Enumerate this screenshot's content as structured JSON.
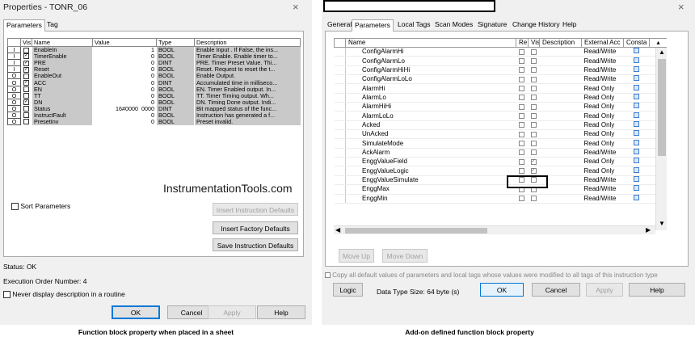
{
  "left_window": {
    "title": "Properties - TONR_06",
    "close": "×",
    "tabs": [
      "Parameters",
      "Tag"
    ],
    "columns": [
      "Vis",
      "Name",
      "Value",
      "Type",
      "Description"
    ],
    "rows": [
      {
        "io": "I",
        "vis": false,
        "name": "EnableIn",
        "value": "1",
        "type": "BOOL",
        "desc": "Enable Input . If False, the ins..."
      },
      {
        "io": "I",
        "vis": true,
        "name": "TimerEnable",
        "value": "0",
        "type": "BOOL",
        "desc": "Timer Enable. Enable timer to..."
      },
      {
        "io": "I",
        "vis": true,
        "name": "PRE",
        "value": "0",
        "type": "DINT",
        "desc": "PRE. Timer Preset Value. Thi..."
      },
      {
        "io": "I",
        "vis": true,
        "name": "Reset",
        "value": "0",
        "type": "BOOL",
        "desc": "Reset. Request to reset the t..."
      },
      {
        "io": "O",
        "vis": false,
        "name": "EnableOut",
        "value": "0",
        "type": "BOOL",
        "desc": "Enable Output."
      },
      {
        "io": "O",
        "vis": true,
        "name": "ACC",
        "value": "0",
        "type": "DINT",
        "desc": "Accumulated time in milliseco..."
      },
      {
        "io": "O",
        "vis": false,
        "name": "EN",
        "value": "0",
        "type": "BOOL",
        "desc": "EN. Timer Enabled output. In..."
      },
      {
        "io": "O",
        "vis": false,
        "name": "TT",
        "value": "0",
        "type": "BOOL",
        "desc": "TT. Timer Timing output. Wh..."
      },
      {
        "io": "O",
        "vis": true,
        "name": "DN",
        "value": "0",
        "type": "BOOL",
        "desc": "DN. Timing Done output. Indi..."
      },
      {
        "io": "O",
        "vis": false,
        "name": "Status",
        "value": "16#0000_0000",
        "type": "DINT",
        "desc": "Bit mapped status of the func..."
      },
      {
        "io": "O",
        "vis": false,
        "name": "InstructFault",
        "value": "0",
        "type": "BOOL",
        "desc": "Instruction has generated a f..."
      },
      {
        "io": "O",
        "vis": false,
        "name": "PresetInv",
        "value": "0",
        "type": "BOOL",
        "desc": "Preset invalid."
      }
    ],
    "watermark": "InstrumentationTools.com",
    "sort_label": "Sort Parameters",
    "btn_insert_instr": "Insert Instruction Defaults",
    "btn_insert_factory": "Insert Factory Defaults",
    "btn_save_instr": "Save Instruction Defaults",
    "status": "Status:  OK",
    "exec_order": "Execution Order Number:  4",
    "never_display": "Never display description in a routine",
    "ok": "OK",
    "cancel": "Cancel",
    "apply": "Apply",
    "help": "Help",
    "caption": "Function block property when placed in a sheet"
  },
  "right_window": {
    "close": "×",
    "tabs": [
      "General",
      "Parameters",
      "Local Tags",
      "Scan Modes",
      "Signature",
      "Change History",
      "Help"
    ],
    "columns": [
      "Name",
      "Re",
      "Vis",
      "Description",
      "External Acc",
      "Consta"
    ],
    "rows": [
      {
        "name": "ConfigAlarmHi",
        "re": false,
        "vis": false,
        "access": "Read/Write"
      },
      {
        "name": "ConfigAlarmLo",
        "re": false,
        "vis": false,
        "access": "Read/Write"
      },
      {
        "name": "ConfigAlarmHiHi",
        "re": false,
        "vis": false,
        "access": "Read/Write"
      },
      {
        "name": "ConfigAlarmLoLo",
        "re": false,
        "vis": false,
        "access": "Read/Write"
      },
      {
        "name": "AlarmHi",
        "re": false,
        "vis": false,
        "access": "Read Only"
      },
      {
        "name": "AlarmLo",
        "re": false,
        "vis": false,
        "access": "Read Only"
      },
      {
        "name": "AlarmHiHi",
        "re": false,
        "vis": false,
        "access": "Read Only"
      },
      {
        "name": "AlarmLoLo",
        "re": false,
        "vis": false,
        "access": "Read Only"
      },
      {
        "name": "Acked",
        "re": false,
        "vis": false,
        "access": "Read Only"
      },
      {
        "name": "UnAcked",
        "re": false,
        "vis": false,
        "access": "Read Only"
      },
      {
        "name": "SimulateMode",
        "re": false,
        "vis": false,
        "access": "Read Only"
      },
      {
        "name": "AckAlarm",
        "re": false,
        "vis": false,
        "access": "Read/Write"
      },
      {
        "name": "EnggValueField",
        "re": false,
        "vis": true,
        "access": "Read Only"
      },
      {
        "name": "EnggValueLogic",
        "re": false,
        "vis": true,
        "access": "Read Only"
      },
      {
        "name": "EnggValueSimulate",
        "re": false,
        "vis": false,
        "access": "Read/Write"
      },
      {
        "name": "EnggMax",
        "re": false,
        "vis": false,
        "access": "Read/Write"
      },
      {
        "name": "EnggMin",
        "re": false,
        "vis": false,
        "access": "Read/Write"
      }
    ],
    "move_up": "Move Up",
    "move_down": "Move Down",
    "copy_defaults": "Copy all default values of parameters and local tags whose values were modified to all tags of this instruction type",
    "logic": "Logic",
    "data_size": "Data Type Size: 64 byte (s)",
    "ok": "OK",
    "cancel": "Cancel",
    "apply": "Apply",
    "help": "Help",
    "caption": "Add-on defined function block property"
  }
}
